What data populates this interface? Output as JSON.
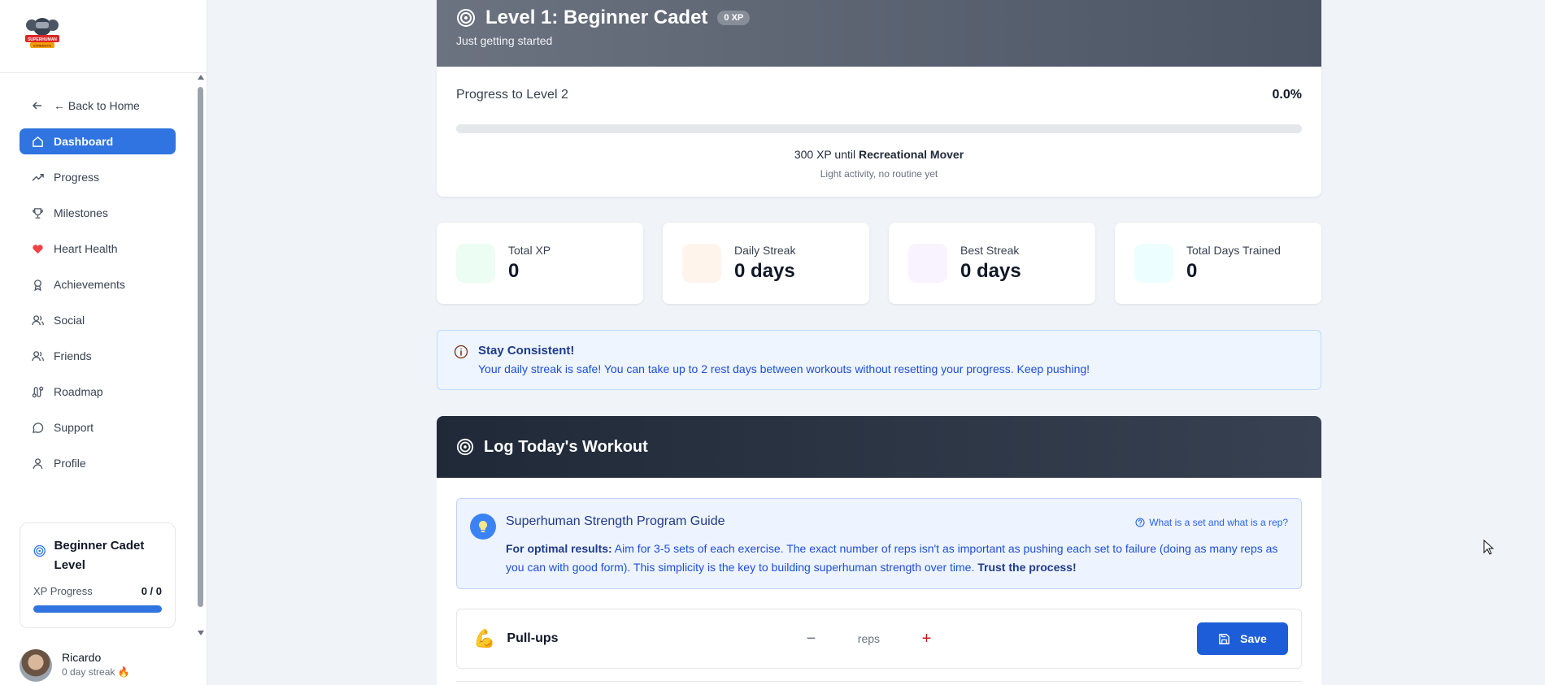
{
  "sidebar": {
    "logo_alt": "SUPERHUMAN STRENGTH",
    "back_label": "← Back to Home",
    "items": [
      {
        "label": "Dashboard",
        "icon": "home-icon"
      },
      {
        "label": "Progress",
        "icon": "trending-up-icon"
      },
      {
        "label": "Milestones",
        "icon": "trophy-icon"
      },
      {
        "label": "Heart Health",
        "icon": "heart-icon"
      },
      {
        "label": "Achievements",
        "icon": "award-icon"
      },
      {
        "label": "Social",
        "icon": "users-icon"
      },
      {
        "label": "Friends",
        "icon": "user-plus-icon"
      },
      {
        "label": "Roadmap",
        "icon": "route-icon"
      },
      {
        "label": "Support",
        "icon": "message-circle-icon"
      },
      {
        "label": "Profile",
        "icon": "user-icon"
      }
    ],
    "active_item": "Dashboard",
    "level_card": {
      "title": "Beginner Cadet Level",
      "xp_label": "XP Progress",
      "xp_value": "0 / 0"
    },
    "user": {
      "name": "Ricardo",
      "streak": "0 day streak 🔥"
    }
  },
  "hero": {
    "title": "Level 1: Beginner Cadet",
    "xp_badge": "0 XP",
    "subtitle": "Just getting started"
  },
  "progress": {
    "label": "Progress to Level 2",
    "percent": "0.0%",
    "fraction": 0.0,
    "xp_until": "300 XP",
    "until_word": "until",
    "next_level": "Recreational Mover",
    "next_desc": "Light activity, no routine yet"
  },
  "stats": [
    {
      "label": "Total XP",
      "value": "0",
      "color": "#ecfdf3"
    },
    {
      "label": "Daily Streak",
      "value": "0 days",
      "color": "#fff4ec"
    },
    {
      "label": "Best Streak",
      "value": "0 days",
      "color": "#f8f3ff"
    },
    {
      "label": "Total Days Trained",
      "value": "0",
      "color": "#ecfeff"
    }
  ],
  "alert": {
    "title": "Stay Consistent!",
    "text": "Your daily streak is safe! You can take up to 2 rest days between workouts without resetting your progress. Keep pushing!"
  },
  "log": {
    "title": "Log Today's Workout",
    "guide": {
      "title": "Superhuman Strength Program Guide",
      "link": "What is a set and what is a rep?",
      "lead": "For optimal results:",
      "body": " Aim for 3-5 sets of each exercise. The exact number of reps isn't as important as pushing each set to failure (doing as many reps as you can with good form). This simplicity is the key to building superhuman strength over time. ",
      "emphasis": "Trust the process!"
    },
    "exercise": {
      "emoji": "💪",
      "name": "Pull-ups",
      "reps_placeholder": "reps",
      "minus": "−",
      "plus": "+",
      "save_label": "Save"
    }
  },
  "colors": {
    "accent": "#2f74e0",
    "hero_dark": "#4b5563",
    "log_header": "#1f2937",
    "alert_bg": "#eef5ff"
  }
}
